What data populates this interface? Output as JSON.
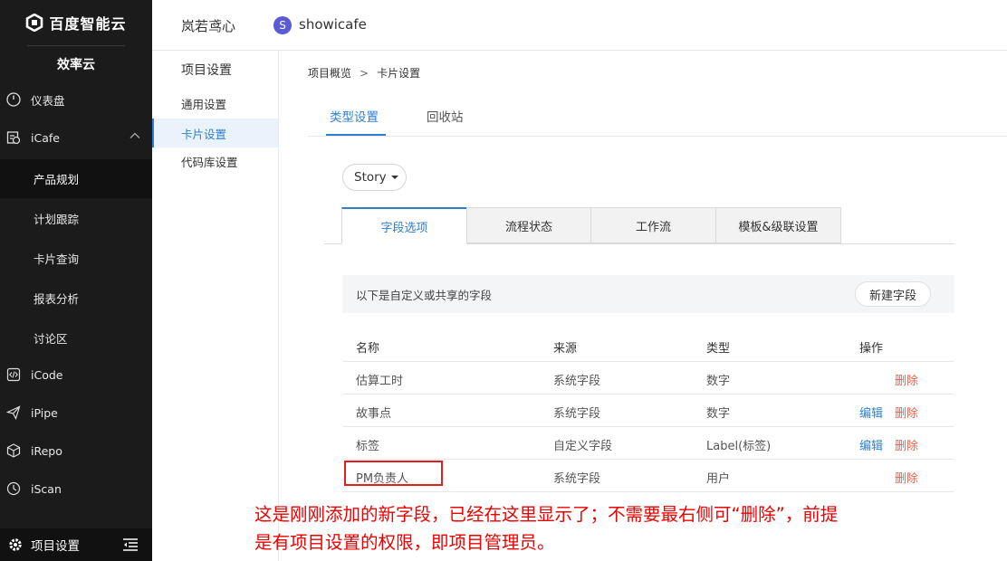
{
  "brand": {
    "name": "百度智能云",
    "product": "效率云"
  },
  "sidebar": {
    "items": [
      {
        "label": "仪表盘",
        "icon": "gauge-icon"
      },
      {
        "label": "iCafe",
        "icon": "icafe-icon",
        "expanded": true
      },
      {
        "label": "产品规划",
        "sub": true,
        "active": true
      },
      {
        "label": "计划跟踪",
        "sub": true
      },
      {
        "label": "卡片查询",
        "sub": true
      },
      {
        "label": "报表分析",
        "sub": true
      },
      {
        "label": "讨论区",
        "sub": true
      },
      {
        "label": "iCode",
        "icon": "code-icon"
      },
      {
        "label": "iPipe",
        "icon": "paper-plane-icon"
      },
      {
        "label": "iRepo",
        "icon": "cube-icon"
      },
      {
        "label": "iScan",
        "icon": "clock-icon"
      }
    ],
    "footer": "项目设置"
  },
  "topbar": {
    "workspace": "岚若鸢心",
    "project_badge": "S",
    "project_name": "showicafe"
  },
  "subnav": {
    "title": "项目设置",
    "items": [
      {
        "label": "通用设置"
      },
      {
        "label": "卡片设置",
        "active": true
      },
      {
        "label": "代码库设置"
      }
    ]
  },
  "breadcrumb": {
    "parent": "项目概览",
    "separator": ">",
    "current": "卡片设置"
  },
  "tabs": [
    {
      "label": "类型设置",
      "active": true
    },
    {
      "label": "回收站"
    }
  ],
  "type_select": {
    "value": "Story"
  },
  "inner_tabs": [
    {
      "label": "字段选项",
      "active": true
    },
    {
      "label": "流程状态"
    },
    {
      "label": "工作流"
    },
    {
      "label": "模板&级联设置"
    }
  ],
  "fields_panel": {
    "description": "以下是自定义或共享的字段",
    "new_button": "新建字段"
  },
  "table": {
    "columns": [
      "名称",
      "来源",
      "类型",
      "操作"
    ],
    "edit_label": "编辑",
    "delete_label": "删除",
    "rows": [
      {
        "name": "估算工时",
        "source": "系统字段",
        "type": "数字",
        "editable": false
      },
      {
        "name": "故事点",
        "source": "系统字段",
        "type": "数字",
        "editable": true
      },
      {
        "name": "标签",
        "source": "自定义字段",
        "type": "Label(标签)",
        "editable": true
      },
      {
        "name": "PM负责人",
        "source": "系统字段",
        "type": "用户",
        "editable": false
      }
    ]
  },
  "annotation": {
    "line1": "这是刚刚添加的新字段，已经在这里显示了；不需要最右侧可“删除”，前提",
    "line2": "是有项目设置的权限，即项目管理员。"
  },
  "colors": {
    "accent": "#2f7fd1",
    "danger": "#e8604c",
    "annotation": "#e00000",
    "sidebar_bg": "#1b1b1b"
  }
}
